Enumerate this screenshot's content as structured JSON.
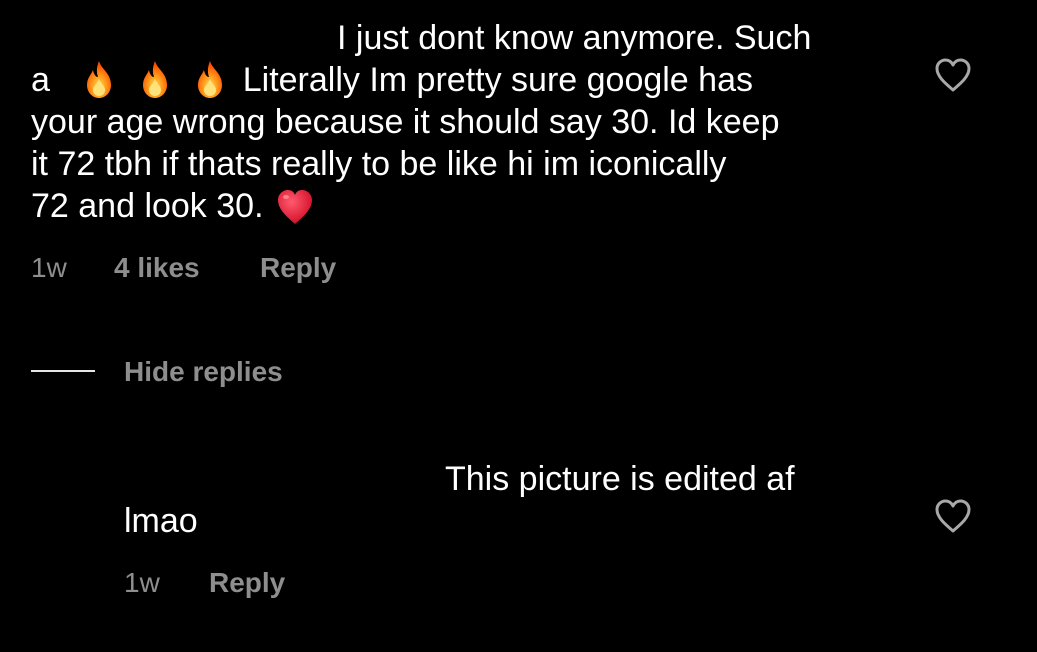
{
  "comment": {
    "lines": [
      "I just dont know anymore. Such",
      "a",
      "Literally Im pretty sure google has",
      "your age wrong because it should say 30. Id keep",
      "it 72 tbh if thats really to be like hi im iconically",
      "72 and look 30."
    ],
    "emojis": [
      "fire-emoji",
      "fire-emoji",
      "fire-emoji",
      "red-heart-emoji"
    ],
    "time": "1w",
    "likes": "4 likes",
    "reply_label": "Reply",
    "like_icon": "heart-outline-icon"
  },
  "replies_toggle": {
    "label": "Hide replies"
  },
  "reply": {
    "lines": [
      "This picture is edited af",
      "lmao"
    ],
    "time": "1w",
    "reply_label": "Reply",
    "like_icon": "heart-outline-icon"
  },
  "colors": {
    "background": "#000000",
    "text": "#ffffff",
    "meta_text": "#8e8e8e",
    "fire": "#ff6a00",
    "heart": "#e0142e"
  }
}
